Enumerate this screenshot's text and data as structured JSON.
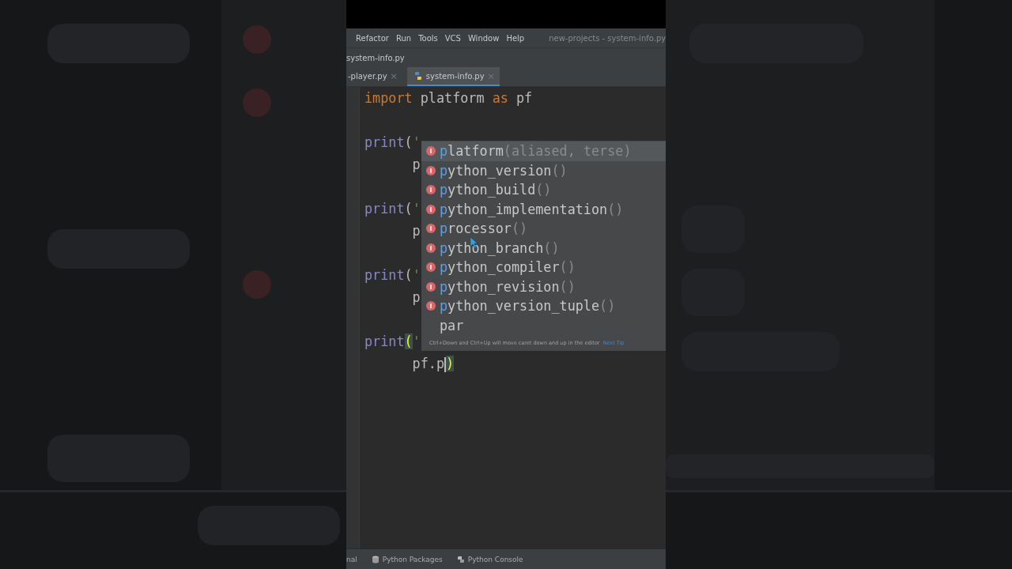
{
  "menu_bar": {
    "items": [
      "Refactor",
      "Run",
      "Tools",
      "VCS",
      "Window",
      "Help"
    ],
    "title": "new-projects - system-info.py"
  },
  "breadcrumb": "system-info.py",
  "tabs": [
    {
      "label": "-player.py",
      "close": "×",
      "selected": false
    },
    {
      "label": "system-info.py",
      "close": "×",
      "selected": true
    }
  ],
  "code_lines": [
    {
      "tokens": [
        {
          "kind": "keyword",
          "text": "import"
        },
        {
          "kind": "plain",
          "text": " platform "
        },
        {
          "kind": "keyword",
          "text": "as"
        },
        {
          "kind": "plain",
          "text": " pf"
        }
      ]
    },
    {
      "kind": "blank"
    },
    {
      "tokens": [
        {
          "kind": "builtin",
          "text": "print"
        },
        {
          "kind": "plain",
          "text": "("
        },
        {
          "kind": "string",
          "text": "'"
        }
      ]
    },
    {
      "tokens": [
        {
          "kind": "plain",
          "text": "      p"
        }
      ]
    },
    {
      "kind": "blank"
    },
    {
      "tokens": [
        {
          "kind": "builtin",
          "text": "print"
        },
        {
          "kind": "plain",
          "text": "("
        },
        {
          "kind": "string",
          "text": "'"
        }
      ]
    },
    {
      "tokens": [
        {
          "kind": "plain",
          "text": "      p"
        }
      ]
    },
    {
      "kind": "blank"
    },
    {
      "tokens": [
        {
          "kind": "builtin",
          "text": "print"
        },
        {
          "kind": "plain",
          "text": "("
        },
        {
          "kind": "string",
          "text": "'"
        }
      ]
    },
    {
      "tokens": [
        {
          "kind": "plain",
          "text": "      p"
        }
      ]
    },
    {
      "kind": "blank"
    },
    {
      "tokens": [
        {
          "kind": "builtin",
          "text": "print"
        },
        {
          "kind": "match",
          "text": "("
        },
        {
          "kind": "string",
          "text": "'"
        }
      ]
    },
    {
      "tokens": [
        {
          "kind": "plain",
          "text": "      pf.p"
        },
        {
          "kind": "match",
          "text": ")",
          "caret": true
        }
      ]
    }
  ],
  "completion": {
    "items": [
      {
        "kind": "function",
        "match": "p",
        "rest": "latform",
        "params": "(aliased, terse)",
        "selected": true
      },
      {
        "kind": "function",
        "match": "p",
        "rest": "ython_version",
        "params": "()",
        "selected": false
      },
      {
        "kind": "function",
        "match": "p",
        "rest": "ython_build",
        "params": "()",
        "selected": false
      },
      {
        "kind": "function",
        "match": "p",
        "rest": "ython_implementation",
        "params": "()",
        "selected": false
      },
      {
        "kind": "function",
        "match": "p",
        "rest": "rocessor",
        "params": "()",
        "selected": false
      },
      {
        "kind": "function",
        "match": "p",
        "rest": "ython_branch",
        "params": "()",
        "selected": false
      },
      {
        "kind": "function",
        "match": "p",
        "rest": "ython_compiler",
        "params": "()",
        "selected": false
      },
      {
        "kind": "function",
        "match": "p",
        "rest": "ython_revision",
        "params": "()",
        "selected": false
      },
      {
        "kind": "function",
        "match": "p",
        "rest": "ython_version_tuple",
        "params": "()",
        "selected": false
      },
      {
        "kind": "text",
        "rest": "par",
        "selected": false
      }
    ],
    "tip": "Ctrl+Down and Ctrl+Up will move caret down and up in the editor",
    "tip_link": "Next Tip"
  },
  "bottom_tabs": [
    {
      "kind": "terminal",
      "label": "nal"
    },
    {
      "kind": "packages",
      "label": "Python Packages"
    },
    {
      "kind": "console",
      "label": "Python Console"
    }
  ]
}
